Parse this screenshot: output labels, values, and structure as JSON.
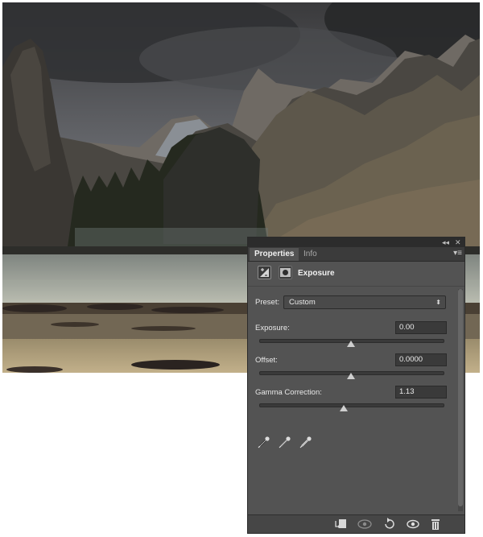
{
  "panel": {
    "collapse_glyph": "◂◂",
    "close_glyph": "✕",
    "tabs": [
      {
        "label": "Properties"
      },
      {
        "label": "Info"
      }
    ],
    "menu_glyph": "▾≡",
    "header": {
      "adjustment_icon": "exposure-adjustment-icon",
      "mask_icon": "layer-mask-icon",
      "title": "Exposure"
    },
    "preset": {
      "label": "Preset:",
      "value": "Custom"
    },
    "controls": [
      {
        "label": "Exposure:",
        "value": "0.00",
        "slider_fraction": 0.5
      },
      {
        "label": "Offset:",
        "value": "0.0000",
        "slider_fraction": 0.5
      },
      {
        "label": "Gamma Correction:",
        "value": "1.13",
        "slider_fraction": 0.46
      }
    ],
    "eyedroppers": [
      "black-point-eyedropper-icon",
      "gray-point-eyedropper-icon",
      "white-point-eyedropper-icon"
    ],
    "footer_icons": [
      "clip-to-layer-icon",
      "view-previous-state-icon",
      "reset-adjustment-icon",
      "toggle-visibility-icon",
      "delete-adjustment-icon"
    ]
  },
  "colors": {
    "panel_bg": "#535353",
    "panel_dark": "#2c2c2c",
    "text": "#e6e6e6"
  }
}
